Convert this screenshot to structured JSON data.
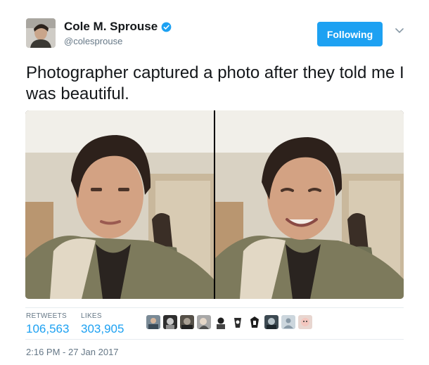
{
  "author": {
    "name": "Cole M. Sprouse",
    "handle": "@colesprouse",
    "verified": true
  },
  "follow_button": {
    "label": "Following",
    "color": "#1da1f2"
  },
  "tweet": {
    "text": "Photographer captured a photo after they told me I was beautiful."
  },
  "media": {
    "photos": [
      {
        "name": "photo-before",
        "expression": "neutral"
      },
      {
        "name": "photo-after",
        "expression": "smiling"
      }
    ]
  },
  "stats": {
    "retweets_label": "RETWEETS",
    "retweets_value": "106,563",
    "likes_label": "LIKES",
    "likes_value": "303,905"
  },
  "likers": {
    "count_shown": 10
  },
  "timestamp": "2:16 PM - 27 Jan 2017",
  "colors": {
    "link_blue": "#1da1f2",
    "muted": "#657786",
    "text": "#14171a"
  }
}
